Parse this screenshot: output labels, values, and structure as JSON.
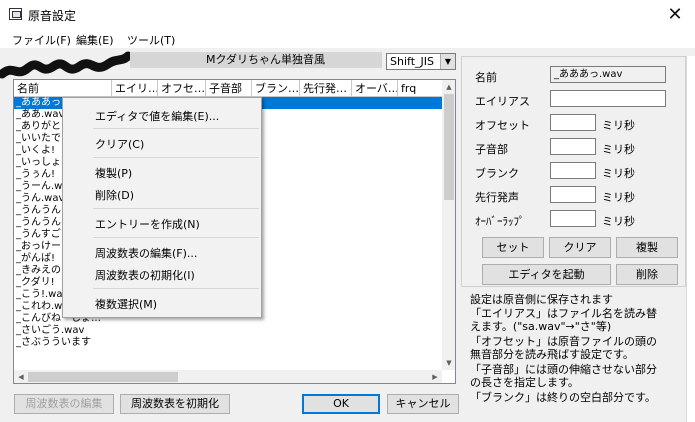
{
  "window": {
    "title": "原音設定",
    "close_glyph": "✕"
  },
  "menu": {
    "items": [
      "ファイル(F)",
      "編集(E)",
      "ツール(T)"
    ]
  },
  "voicebank": {
    "name": "Mクダリちゃん単独音風"
  },
  "encoding": {
    "value": "Shift_JIS"
  },
  "table": {
    "columns": [
      "名前",
      "エイリ…",
      "オフセ…",
      "子音部",
      "ブラン…",
      "先行発…",
      "オーバ…",
      "frq"
    ],
    "rows": [
      "_あああっ.wav",
      "_ああ.wav",
      "_ありがと",
      "_いいたで",
      "_いくよ!",
      "_いっしょ",
      "_うぅん!",
      "_うーん.wav",
      "_うん.wav",
      "_うんうん",
      "_うんうん",
      "_うんすご",
      "_おっけー",
      "_がんば!",
      "_きみえの",
      "_クダリ!",
      "_こう!.wav",
      "_これわ.wav",
      "_こんびねーしょ…",
      "_さいごう.wav",
      "_さぶうういます"
    ]
  },
  "context_menu": {
    "items": [
      "エディタで値を編集(E)...",
      "クリア(C)",
      "複製(P)",
      "削除(D)",
      "エントリーを作成(N)",
      "周波数表の編集(F)...",
      "周波数表の初期化(I)",
      "複数選択(M)"
    ]
  },
  "panel": {
    "fields": {
      "name_label": "名前",
      "name_value": "_あああっ.wav",
      "alias_label": "エイリアス",
      "alias_value": "",
      "offset_label": "オフセット",
      "offset_value": "",
      "consonant_label": "子音部",
      "consonant_value": "",
      "blank_label": "ブランク",
      "blank_value": "",
      "preutter_label": "先行発声",
      "preutter_value": "",
      "overlap_label": "ｵｰﾊﾞｰﾗｯﾌﾟ",
      "overlap_value": ""
    },
    "unit": "ミリ秒",
    "buttons": {
      "set": "セット",
      "clear": "クリア",
      "duplicate": "複製",
      "launch_editor": "エディタを起動",
      "delete": "削除"
    }
  },
  "notes": [
    "設定は原音側に保存されます",
    "「エイリアス」はファイル名を読み替",
    "えます。(\"sa.wav\"→\"さ\"等)",
    "「オフセット」は原音ファイルの頭の",
    "無音部分を読み飛ばす設定です。",
    "「子音部」には頭の伸縮させない部分",
    "の長さを指定します。",
    "「ブランク」は終りの空白部分です。"
  ],
  "bottom_buttons": {
    "freq_edit": "周波数表の編集",
    "freq_init": "周波数表を初期化",
    "ok": "OK",
    "cancel": "キャンセル"
  }
}
